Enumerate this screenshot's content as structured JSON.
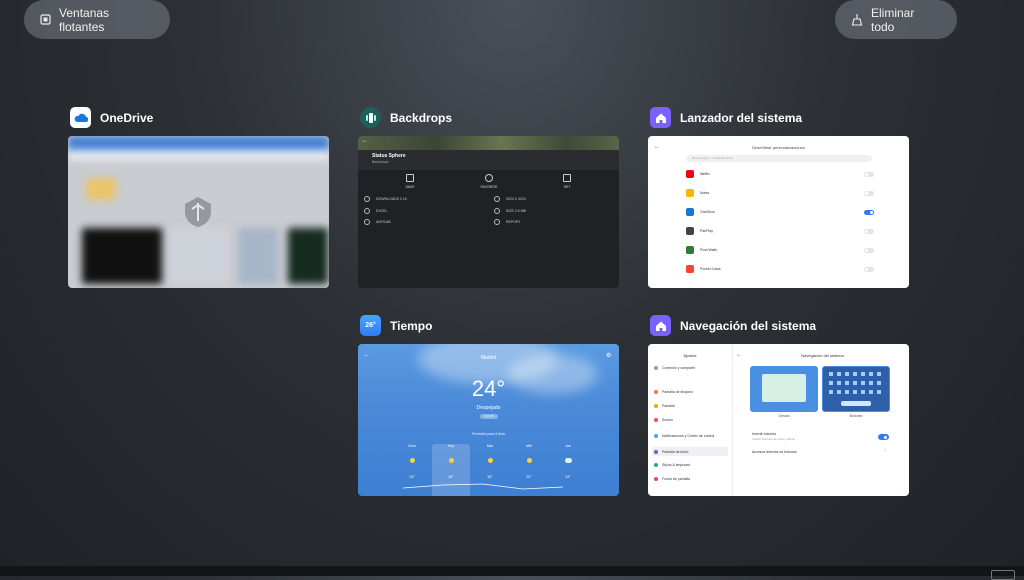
{
  "top_bar": {
    "floating_windows_label": "Ventanas flotantes",
    "clear_all_label": "Eliminar todo"
  },
  "cards": {
    "onedrive": {
      "title": "OneDrive",
      "icon": "onedrive-cloud-icon"
    },
    "backdrops": {
      "title": "Backdrops",
      "wallpaper_title": "Status Sphere",
      "wallpaper_subtitle": "Backdrops",
      "actions": [
        "SAVE",
        "FAVORITE",
        "SET"
      ],
      "info": [
        "DOWNLOADS 2.1K",
        "3024 X 3024",
        "EXCEL",
        "SIZE 2.6 MB",
        "ANTILAB",
        "REPORT"
      ]
    },
    "launcher": {
      "title": "Lanzador del sistema",
      "screen_title": "Deseñhear personalizaciones",
      "search_placeholder": "Buscar apps o configuraciones",
      "apps": [
        {
          "name": "Netflix",
          "color": "#e50914",
          "on": false
        },
        {
          "name": "Notes",
          "color": "#f5b700",
          "on": false
        },
        {
          "name": "OneDrive",
          "color": "#1976d2",
          "on": true
        },
        {
          "name": "PairPlay",
          "color": "#444444",
          "on": false
        },
        {
          "name": "Pixel Walls",
          "color": "#2e7d32",
          "on": false
        },
        {
          "name": "Pocket Casts",
          "color": "#f44336",
          "on": false
        }
      ]
    },
    "weather": {
      "title": "Tiempo",
      "icon_text": "26°",
      "city": "Madrid",
      "temperature": "24°",
      "condition": "Despejado",
      "air_quality": "AQI 35",
      "forecast_label": "Previsión para 5 días",
      "days": [
        {
          "name": "Dom",
          "temp": "24°",
          "icon": "sun"
        },
        {
          "name": "Hoy",
          "temp": "26°",
          "icon": "sun"
        },
        {
          "name": "Mar",
          "temp": "26°",
          "icon": "sun"
        },
        {
          "name": "Mié",
          "temp": "23°",
          "icon": "sun"
        },
        {
          "name": "Jue",
          "temp": "24°",
          "icon": "cloud"
        }
      ]
    },
    "navigation": {
      "title": "Navegación del sistema",
      "sidebar_title": "Ajustes",
      "sidebar_items": [
        {
          "label": "Conexión y compartir",
          "color": "#9e9e9e"
        },
        {
          "label": "Pantalla de bloqueo",
          "color": "#ff7043"
        },
        {
          "label": "Pantalla",
          "color": "#ffa000"
        },
        {
          "label": "Sonido",
          "color": "#ef5350"
        },
        {
          "label": "Notificaciones y Centro de control",
          "color": "#42a5f5"
        },
        {
          "label": "Pantalla de inicio",
          "color": "#7e57c2"
        },
        {
          "label": "Stylus & keyboard",
          "color": "#26a69a"
        },
        {
          "label": "Fondo de pantalla",
          "color": "#ec407a"
        }
      ],
      "main_title": "Navegación del sistema",
      "option_gestures": "Gestos",
      "option_buttons": "Botones",
      "invert_label": "Invertir botones",
      "invert_sub": "Invertir botones de inicio y Menú",
      "shortcuts_label": "Accesos directos de botones"
    }
  }
}
